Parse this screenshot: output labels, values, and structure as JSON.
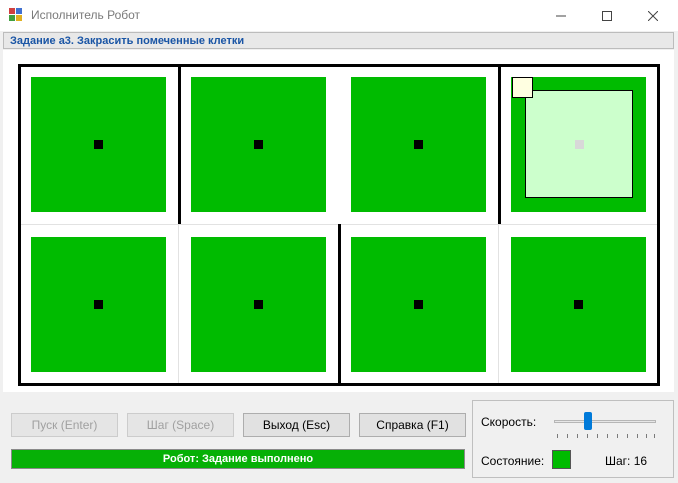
{
  "window": {
    "title": "Исполнитель Робот",
    "minimize_icon": "minimize-icon",
    "maximize_icon": "maximize-icon",
    "close_icon": "close-icon"
  },
  "task": {
    "label": "Задание а3. Закрасить помеченные клетки"
  },
  "field": {
    "rows": 2,
    "cols": 4,
    "cell_color": "#00bb00",
    "robot_cell_color": "#ccffcc",
    "robot_position": {
      "row": 1,
      "col": 4
    }
  },
  "buttons": {
    "start": "Пуск (Enter)",
    "step": "Шаг (Space)",
    "exit": "Выход (Esc)",
    "help": "Справка (F1)"
  },
  "status": {
    "message": "Робот: Задание выполнено",
    "color": "#06b006"
  },
  "panel": {
    "speed_label": "Скорость:",
    "speed_level": 0.33,
    "state_label": "Состояние:",
    "state_color": "#00bb00",
    "step_label": "Шаг: 16"
  }
}
